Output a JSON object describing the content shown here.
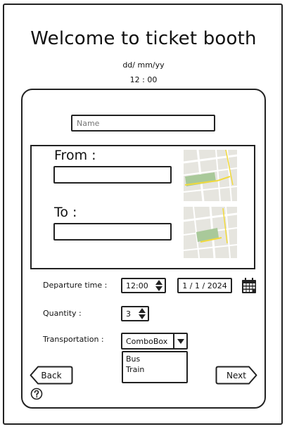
{
  "header": {
    "title": "Welcome to ticket booth",
    "date": "dd/ mm/yy",
    "time": "12 : 00"
  },
  "form": {
    "name_placeholder": "Name",
    "from_label": "From :",
    "to_label": "To :",
    "departure_label": "Departure time :",
    "departure_time": "12:00",
    "departure_date": "1 / 1 / 2024",
    "quantity_label": "Quantity :",
    "quantity_value": "3",
    "transportation_label": "Transportation :",
    "transportation_value": "ComboBox",
    "transportation_options": [
      "Bus",
      "Train"
    ]
  },
  "buttons": {
    "back": "Back",
    "next": "Next"
  },
  "icons": {
    "calendar": "calendar-icon",
    "help": "help-icon",
    "map": "map-icon"
  }
}
